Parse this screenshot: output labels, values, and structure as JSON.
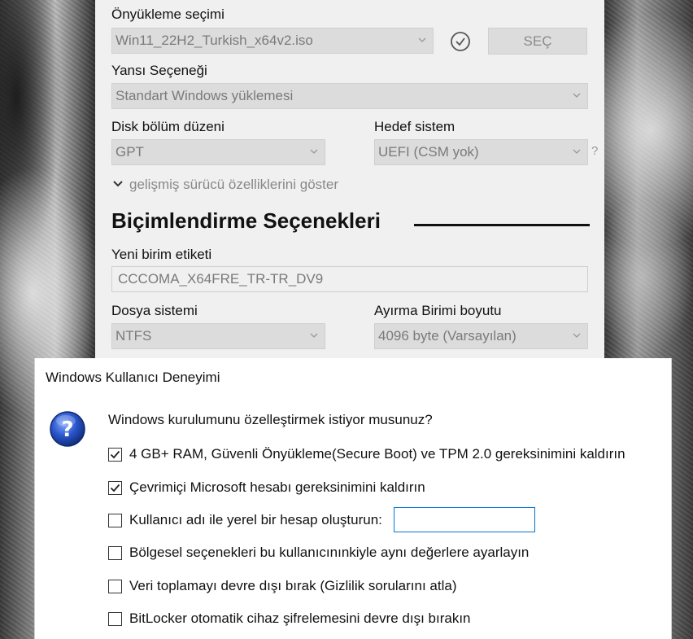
{
  "rufus": {
    "boot_selection_label": "Önyükleme seçimi",
    "boot_selection_value": "Win11_22H2_Turkish_x64v2.iso",
    "select_button": "SEÇ",
    "image_option_label": "Yansı Seçeneği",
    "image_option_value": "Standart Windows yüklemesi",
    "partition_scheme_label": "Disk bölüm düzeni",
    "partition_scheme_value": "GPT",
    "target_system_label": "Hedef sistem",
    "target_system_value": "UEFI (CSM yok)",
    "target_help": "?",
    "advanced_drive_toggle": "gelişmiş sürücü özelliklerini göster",
    "format_section_title": "Biçimlendirme Seçenekleri",
    "volume_label_label": "Yeni birim etiketi",
    "volume_label_value": "CCCOMA_X64FRE_TR-TR_DV9",
    "file_system_label": "Dosya sistemi",
    "file_system_value": "NTFS",
    "cluster_size_label": "Ayırma Birimi boyutu",
    "cluster_size_value": "4096 byte (Varsayılan)"
  },
  "dialog": {
    "title": "Windows Kullanıcı Deneyimi",
    "question": "Windows kurulumunu özelleştirmek istiyor musunuz?",
    "options": [
      {
        "label": "4 GB+ RAM, Güvenli Önyükleme(Secure Boot) ve TPM 2.0 gereksinimini kaldırın",
        "checked": true
      },
      {
        "label": "Çevrimiçi Microsoft hesabı gereksinimini kaldırın",
        "checked": true
      },
      {
        "label": "Kullanıcı adı ile yerel bir hesap oluşturun:",
        "checked": false
      },
      {
        "label": "Bölgesel seçenekleri bu kullanıcınınkiyle aynı değerlere ayarlayın",
        "checked": false
      },
      {
        "label": "Veri toplamayı devre dışı bırak (Gizlilik sorularını atla)",
        "checked": false
      },
      {
        "label": "BitLocker otomatik cihaz şifrelemesini devre dışı bırakın",
        "checked": false
      }
    ],
    "local_account_username_value": ""
  },
  "colors": {
    "panel_bg": "#f0f0f0",
    "disabled_control": "#dcdcdc",
    "input_focus_border": "#0078d7",
    "help_icon_blue": "#2050c0"
  },
  "icons": [
    "check-circle-icon",
    "chevron-down-icon",
    "question-icon",
    "checkmark-icon"
  ]
}
